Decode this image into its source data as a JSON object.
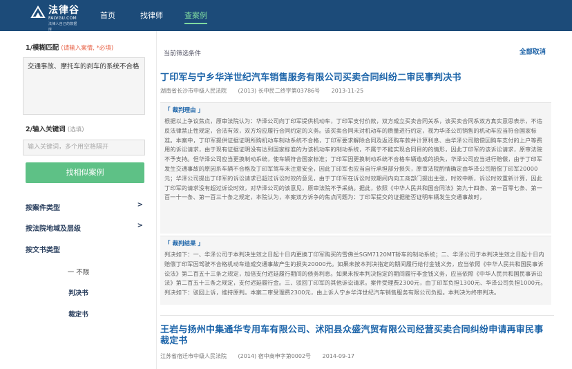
{
  "brand": {
    "name_cn": "法律谷",
    "name_en": "FALVGU.COM",
    "tagline": "法律人自己的数据库"
  },
  "nav": {
    "items": [
      {
        "label": "首页",
        "active": false
      },
      {
        "label": "找律师",
        "active": false
      },
      {
        "label": "查案例",
        "active": true
      }
    ]
  },
  "sidebar": {
    "fuzzy_label": "1/模糊匹配",
    "fuzzy_hint": "(请输入案情, *必填)",
    "fuzzy_value": "交通事故、摩托车的刹车的系统不合格",
    "keyword_label": "2/输入关键词",
    "keyword_hint": "(选填)",
    "keyword_placeholder": "输入关键词，多个用空格隔开",
    "search_button": "找相似案例",
    "filters": [
      {
        "label": "按案件类型",
        "chevron": ">"
      },
      {
        "label": "按法院地域及层级",
        "chevron": ">"
      },
      {
        "label": "按文书类型",
        "chevron": ""
      }
    ],
    "doc_types": [
      "一 不限",
      "判决书",
      "裁定书"
    ]
  },
  "main": {
    "filter_heading": "当前筛选条件",
    "clear_all": "全部取消",
    "cases": [
      {
        "title": "丁印军与宁乡华洋世纪汽车销售服务有限公司买卖合同纠纷二审民事判决书",
        "court": "湖南省长沙市中级人民法院",
        "case_no": "(2013) 长中民二终字第03786号",
        "date": "2013-11-25",
        "reason_head": "「 裁判理由 」",
        "reason_text": "根据以上争议焦点，原审法院认为：华泽公司向丁印军提供机动车，丁印军支付价款，双方成立买卖合同关系，该买卖合同系双方真实意思表示，不违反法律禁止性规定，合法有效，双方均应履行合同约定的义务。该买卖合同未对机动车的质量进行约定，视为华泽公司销售的机动车应当符合国家标准。本案中，丁印军提供证据证明所购机动车制动系统不合格，丁印军要求解除合同及返还购车款并计算利息、由华泽公司赔偿因购车支付的上户等费用的诉讼请求，由于现有证据证明没有达到国家标准的为该机动车的制动系统，不属于不能实现合同目的的情形，因此丁印军的该诉讼请求，原审法院不予支持。但华泽公司应当更换制动系统，使车辆符合国家标准；丁印军因更换制动系统不合格车辆造成的损失，华泽公司应当进行赔偿，由于丁印军发生交通事故的原因系车辆不合格及丁印军驾车未注意安全，因此丁印军也应当自行承担部分损失，原审法院酌情确定由华泽公司赔偿丁印军20000元；华泽公司提出丁印军的诉讼请求已超过诉讼时效的意见，由于丁印军在诉讼时效期间内向工商部门提出主张，时效中断，诉讼时效重新计算，因此丁印军的请求没有超过诉讼时效，对华泽公司的该意见，原审法院不予采纳。据此，依照《中华人民共和国合同法》第九十四条、第一百零七条、第一百一十一条、第一百三十条之规定，本院认为，本案双方诉争的焦点问题为：丁印军提交的证据能否证明车辆发生交通事故时，",
        "result_head": "「 裁判结果 」",
        "result_text": "判决如下：一、华泽公司于本判决生效之日起十日内更换丁印军购买的雪佛兰SGM7120MT轿车的制动系统；二、华泽公司于本判决生效之日起十日内赔偿丁印军因驾驶不合格机动车造成交通事故产生的损失20000元。如果未按本判决指定的期间履行给付金钱义务，应当依照《中华人民共和国民事诉讼法》第二百五十三条之规定，加倍支付迟延履行期间的债务利息。如果未按本判决指定的期间履行非金钱义务，应当依照《中华人民共和国民事诉讼法》第二百五十三条之规定，支付迟延履行金。三、驳回丁印军的其他诉讼请求。案件受理费2300元，由丁印军负担1300元、华泽公司负担1000元。判决如下：驳回上诉，维持原判。本案二审受理费2300元，由上诉人宁乡华洋世纪汽车销售服务有限公司负担。本判决为终审判决。"
      },
      {
        "title": "王岩与扬州中集通华专用车有限公司、沭阳县众盛汽贸有限公司经营买卖合同纠纷申请再审民事裁定书",
        "court": "江苏省宿迁市中级人民法院",
        "case_no": "(2014) 宿中商申字第0002号",
        "date": "2014-09-17"
      }
    ]
  },
  "colors": {
    "topbar": "#1c4b79",
    "nav_active": "#7fd9a0",
    "accent_green": "#5ec186",
    "title_blue": "#1c64a9",
    "hint_red": "#e8654a"
  }
}
